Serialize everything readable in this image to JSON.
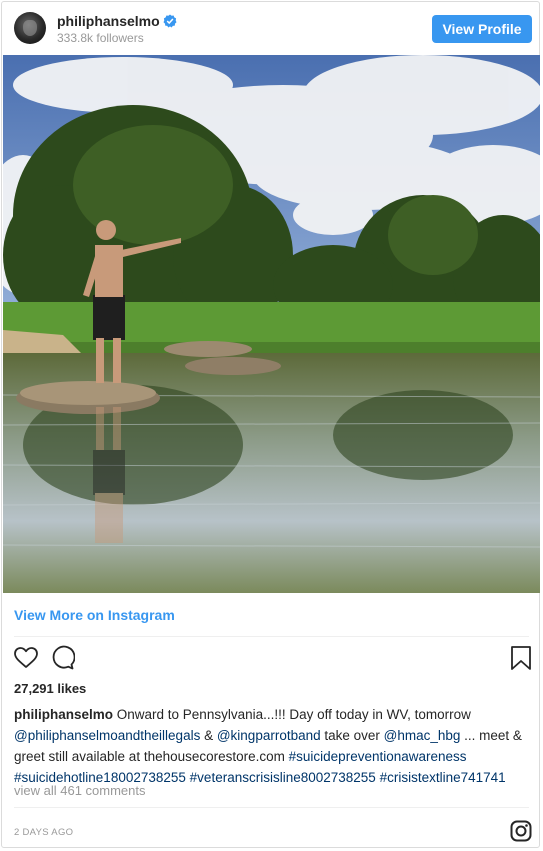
{
  "header": {
    "username": "philiphanselmo",
    "followers": "333.8k followers",
    "view_profile_label": "View Profile"
  },
  "post": {
    "view_more_label": "View More on Instagram",
    "likes": "27,291 likes",
    "caption": {
      "username": "philiphanselmo",
      "text_1": " Onward to Pennsylvania...!!! Day off today in WV, tomorrow ",
      "mention_1": "@philiphanselmoandtheillegals",
      "text_2": " & ",
      "mention_2": "@kingparrotband",
      "text_3": " take over ",
      "mention_3": "@hmac_hbg",
      "text_4": " ... meet & greet still available at thehousecorestore.com ",
      "tag_1": "#suicidepreventionawareness",
      "tag_2": "#suicidehotline18002738255",
      "tag_3": "#veteranscrisisline8002738255",
      "tag_4": "#crisistextline741741"
    },
    "comments_link": "view all 461 comments",
    "timestamp": "2 DAYS AGO"
  },
  "icons": {
    "avatar": "avatar-image",
    "verified": "verified-badge-icon",
    "like": "heart-icon",
    "comment": "comment-bubble-icon",
    "save": "bookmark-icon",
    "brand": "instagram-logo-icon"
  },
  "colors": {
    "accent": "#3897f0",
    "link": "#003569",
    "muted": "#999999",
    "text": "#262626"
  }
}
